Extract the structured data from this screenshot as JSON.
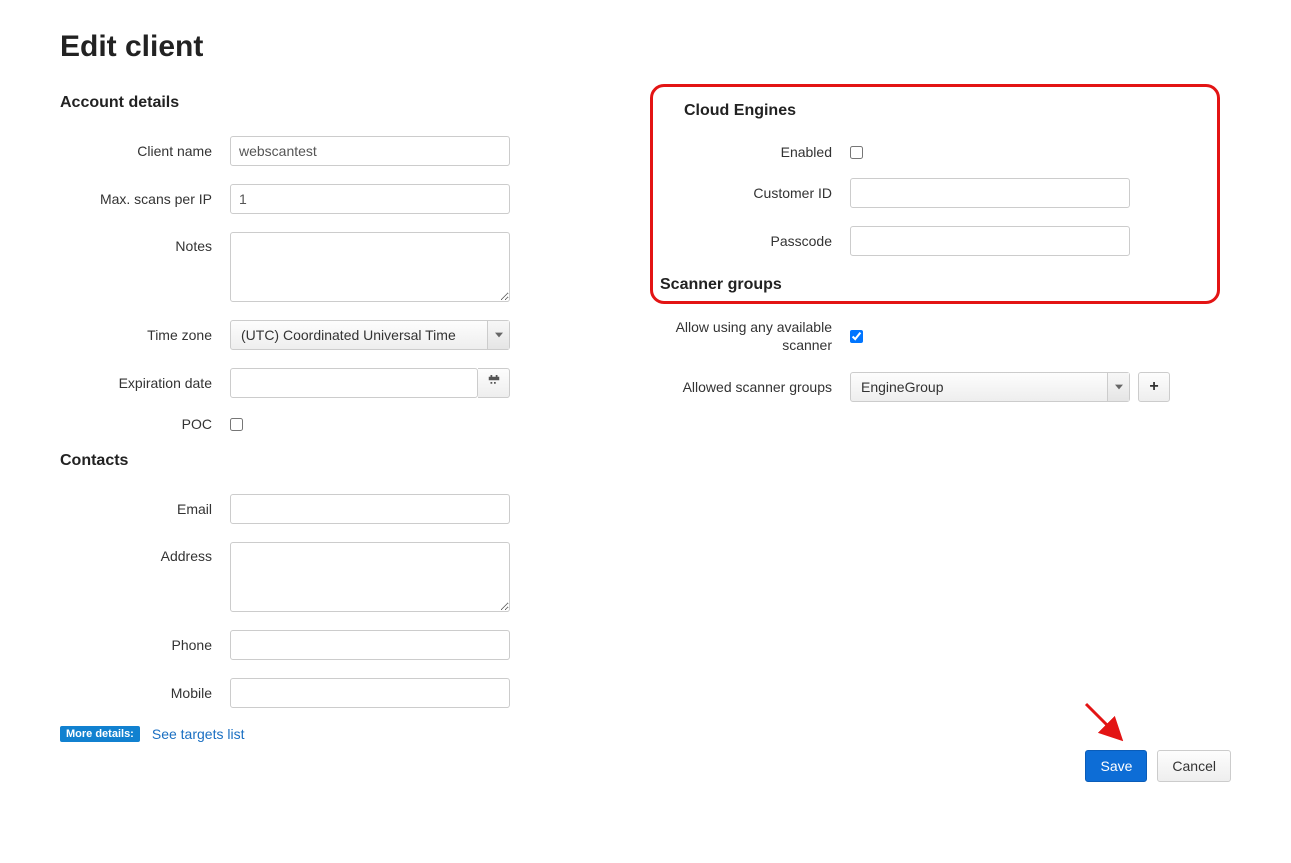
{
  "page": {
    "title": "Edit client"
  },
  "account": {
    "section_title": "Account details",
    "labels": {
      "client_name": "Client name",
      "max_scans": "Max. scans per IP",
      "notes": "Notes",
      "time_zone": "Time zone",
      "expiration": "Expiration date",
      "poc": "POC"
    },
    "values": {
      "client_name": "webscantest",
      "max_scans": "1",
      "notes": "",
      "time_zone": "(UTC) Coordinated Universal Time",
      "expiration": "",
      "poc_checked": false
    }
  },
  "contacts": {
    "section_title": "Contacts",
    "labels": {
      "email": "Email",
      "address": "Address",
      "phone": "Phone",
      "mobile": "Mobile"
    },
    "values": {
      "email": "",
      "address": "",
      "phone": "",
      "mobile": ""
    }
  },
  "cloud": {
    "section_title": "Cloud Engines",
    "labels": {
      "enabled": "Enabled",
      "customer_id": "Customer ID",
      "passcode": "Passcode"
    },
    "values": {
      "enabled_checked": false,
      "customer_id": "",
      "passcode": ""
    }
  },
  "scanner": {
    "section_title": "Scanner groups",
    "labels": {
      "allow_any": "Allow using any available scanner",
      "allowed_groups": "Allowed scanner groups"
    },
    "values": {
      "allow_any_checked": true,
      "allowed_groups_selected": "EngineGroup"
    }
  },
  "more": {
    "badge": "More details:",
    "link": "See targets list"
  },
  "buttons": {
    "save": "Save",
    "cancel": "Cancel"
  }
}
